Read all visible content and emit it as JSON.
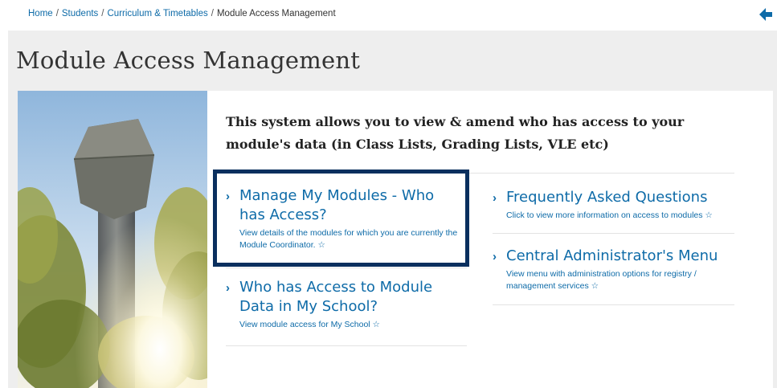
{
  "breadcrumb": {
    "items": [
      "Home",
      "Students",
      "Curriculum & Timetables"
    ],
    "current": "Module Access Management",
    "separator": "/"
  },
  "page": {
    "title": "Module Access Management",
    "intro": "This system allows you to view & amend who has access to your module's data (in Class Lists, Grading Lists, VLE etc)"
  },
  "links": {
    "manage_modules": {
      "title": "Manage My Modules - Who has Access?",
      "description": "View details of the modules for which you are currently the Module Coordinator. ☆"
    },
    "school_access": {
      "title": "Who has Access to Module Data in My School?",
      "description": "View module access for My School ☆"
    },
    "faq": {
      "title": "Frequently Asked Questions",
      "description": "Click to view more information on access to modules ☆"
    },
    "central_admin": {
      "title": "Central Administrator's Menu",
      "description": "View menu with administration options for registry / management services ☆"
    }
  },
  "icons": {
    "back": "back-arrow-icon",
    "chevron": "chevron-right-icon"
  },
  "colors": {
    "link": "#0e6ba8",
    "highlight": "#0a2f5e",
    "background": "#eeeeee"
  }
}
